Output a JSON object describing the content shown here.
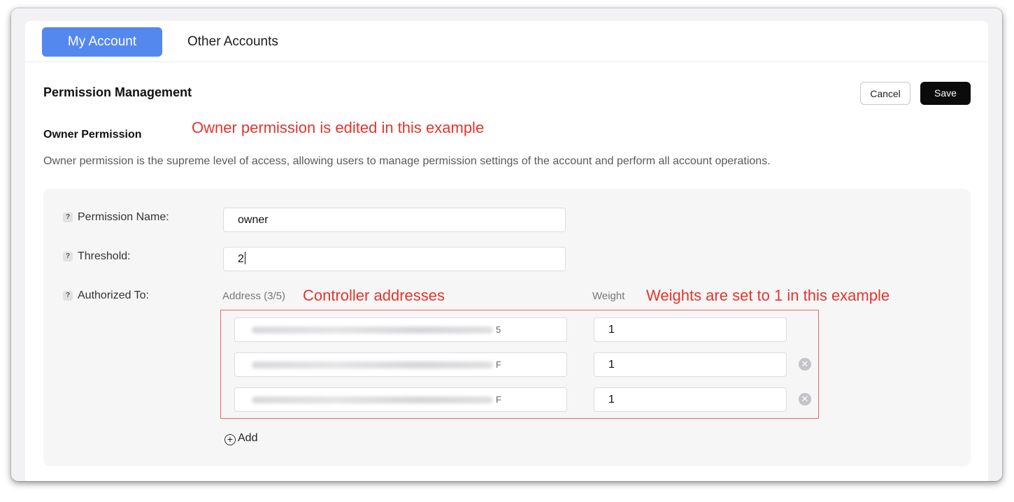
{
  "tabs": [
    {
      "label": "My Account",
      "active": true
    },
    {
      "label": "Other Accounts",
      "active": false
    }
  ],
  "header": {
    "title": "Permission Management",
    "cancel_label": "Cancel",
    "save_label": "Save"
  },
  "owner": {
    "title": "Owner Permission",
    "description": "Owner permission is the supreme level of access, allowing users to manage permission settings of the account and perform all account operations."
  },
  "form": {
    "name_label": "Permission Name:",
    "name_value": "owner",
    "threshold_label": "Threshold:",
    "threshold_value": "2",
    "authorized_label": "Authorized To:",
    "help_icon": "?",
    "address_header": "Address (3/5)",
    "weight_header": "Weight",
    "rows": [
      {
        "address_tail": "5",
        "weight": "1",
        "removable": false
      },
      {
        "address_tail": "F",
        "weight": "1",
        "removable": true
      },
      {
        "address_tail": "F",
        "weight": "1",
        "removable": true
      }
    ],
    "add_label": "Add",
    "remove_icon": "✕",
    "add_icon": "+"
  },
  "annotations": {
    "owner_note": "Owner permission is edited in this example",
    "controller_note": "Controller addresses",
    "weight_note": "Weights are set to 1 in this example",
    "color": "#e4352d"
  },
  "colors": {
    "accent": "#5488ef",
    "save_button": "#0b0b0c"
  }
}
